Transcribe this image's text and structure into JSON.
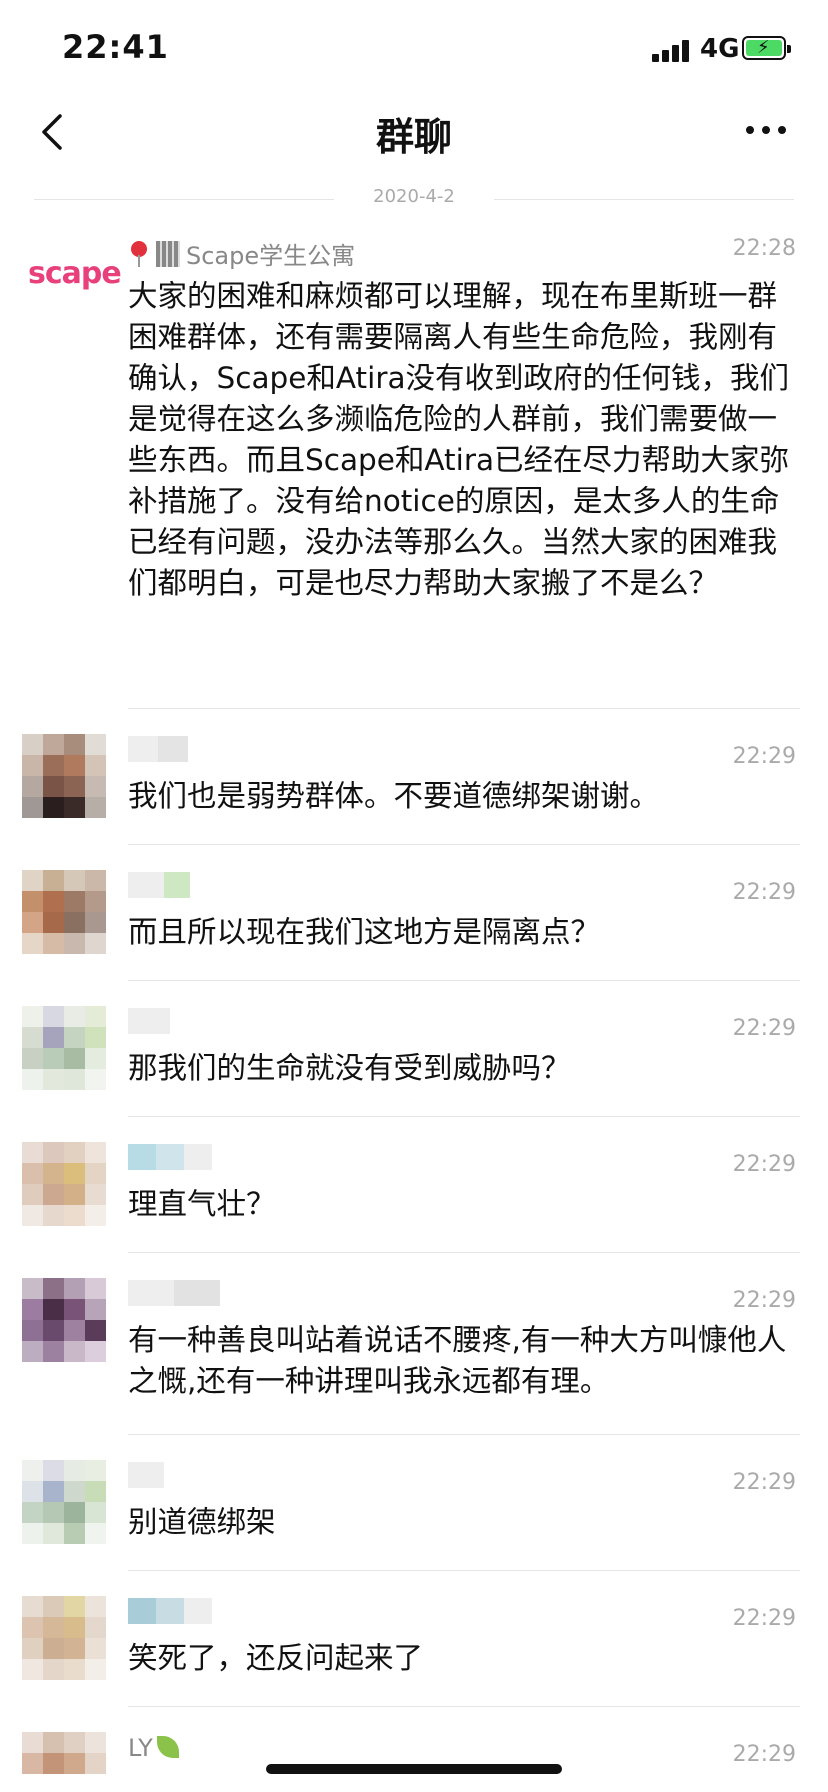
{
  "status_bar": {
    "time": "22:41",
    "network": "4G"
  },
  "nav": {
    "title": "群聊"
  },
  "date_divider": "2020-4-2",
  "messages": [
    {
      "sender": "Scape学生公寓",
      "time": "22:28",
      "text": "大家的困难和麻烦都可以理解，现在布里斯班一群困难群体，还有需要隔离人有些生命危险，我刚有确认，Scape和Atira没有收到政府的任何钱，我们是觉得在这么多濒临危险的人群前，我们需要做一些东西。而且Scape和Atira已经在尽力帮助大家弥补措施了。没有给notice的原因，是太多人的生命已经有问题，没办法等那么久。当然大家的困难我们都明白，可是也尽力帮助大家搬了不是么？",
      "avatar_logo": "scape"
    },
    {
      "time": "22:29",
      "text": "我们也是弱势群体。不要道德绑架谢谢。"
    },
    {
      "time": "22:29",
      "text": "而且所以现在我们这地方是隔离点？"
    },
    {
      "time": "22:29",
      "text": "那我们的生命就没有受到威胁吗？"
    },
    {
      "time": "22:29",
      "text": "理直气壮？"
    },
    {
      "time": "22:29",
      "text": "有一种善良叫站着说话不腰疼,有一种大方叫慷他人之慨,还有一种讲理叫我永远都有理。"
    },
    {
      "time": "22:29",
      "text": "别道德绑架"
    },
    {
      "time": "22:29",
      "text": "笑死了，还反问起来了"
    },
    {
      "sender": "LY",
      "time": "22:29"
    }
  ],
  "colors": {
    "logo": "#e8407a",
    "battery": "#4cd964",
    "secondary_text": "#aaaaaa"
  },
  "icons": [
    "back-icon",
    "more-icon",
    "signal-icon",
    "battery-icon",
    "pin-icon",
    "building-icon",
    "leaf-icon"
  ]
}
